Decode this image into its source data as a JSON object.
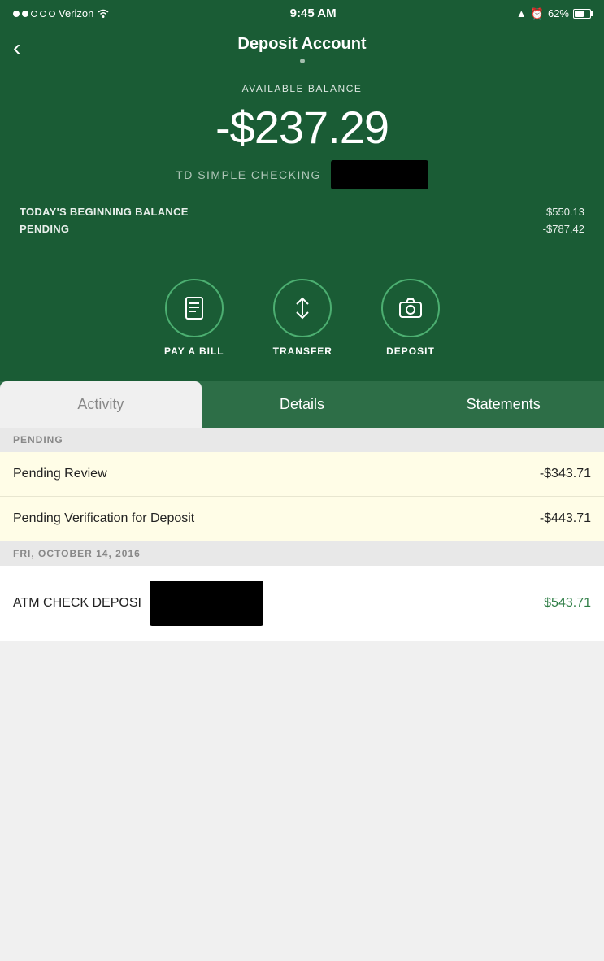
{
  "statusBar": {
    "carrier": "Verizon",
    "time": "9:45 AM",
    "battery": "62%"
  },
  "header": {
    "title": "Deposit Account",
    "backLabel": "‹"
  },
  "account": {
    "availableBalanceLabel": "AVAILABLE BALANCE",
    "balance": "-$237.29",
    "accountName": "TD SIMPLE CHECKING",
    "todayBeginningBalanceLabel": "TODAY'S BEGINNING BALANCE",
    "todayBeginningBalanceValue": "$550.13",
    "pendingLabel": "PENDING",
    "pendingValue": "-$787.42"
  },
  "actions": [
    {
      "id": "pay-a-bill",
      "label": "PAY A BILL",
      "icon": "bill"
    },
    {
      "id": "transfer",
      "label": "TRANSFER",
      "icon": "transfer"
    },
    {
      "id": "deposit",
      "label": "DEPOSIT",
      "icon": "camera"
    }
  ],
  "tabs": [
    {
      "id": "activity",
      "label": "Activity",
      "active": true
    },
    {
      "id": "details",
      "label": "Details",
      "active": false
    },
    {
      "id": "statements",
      "label": "Statements",
      "active": false
    }
  ],
  "pendingSectionLabel": "PENDING",
  "transactions": [
    {
      "name": "Pending Review",
      "amount": "-$343.71",
      "type": "pending"
    },
    {
      "name": "Pending Verification for Deposit",
      "amount": "-$443.71",
      "type": "pending"
    }
  ],
  "dateSectionLabel": "FRI, OCTOBER 14, 2016",
  "atmTransaction": {
    "label": "ATM CHECK DEPOSI",
    "amount": "$543.71"
  }
}
